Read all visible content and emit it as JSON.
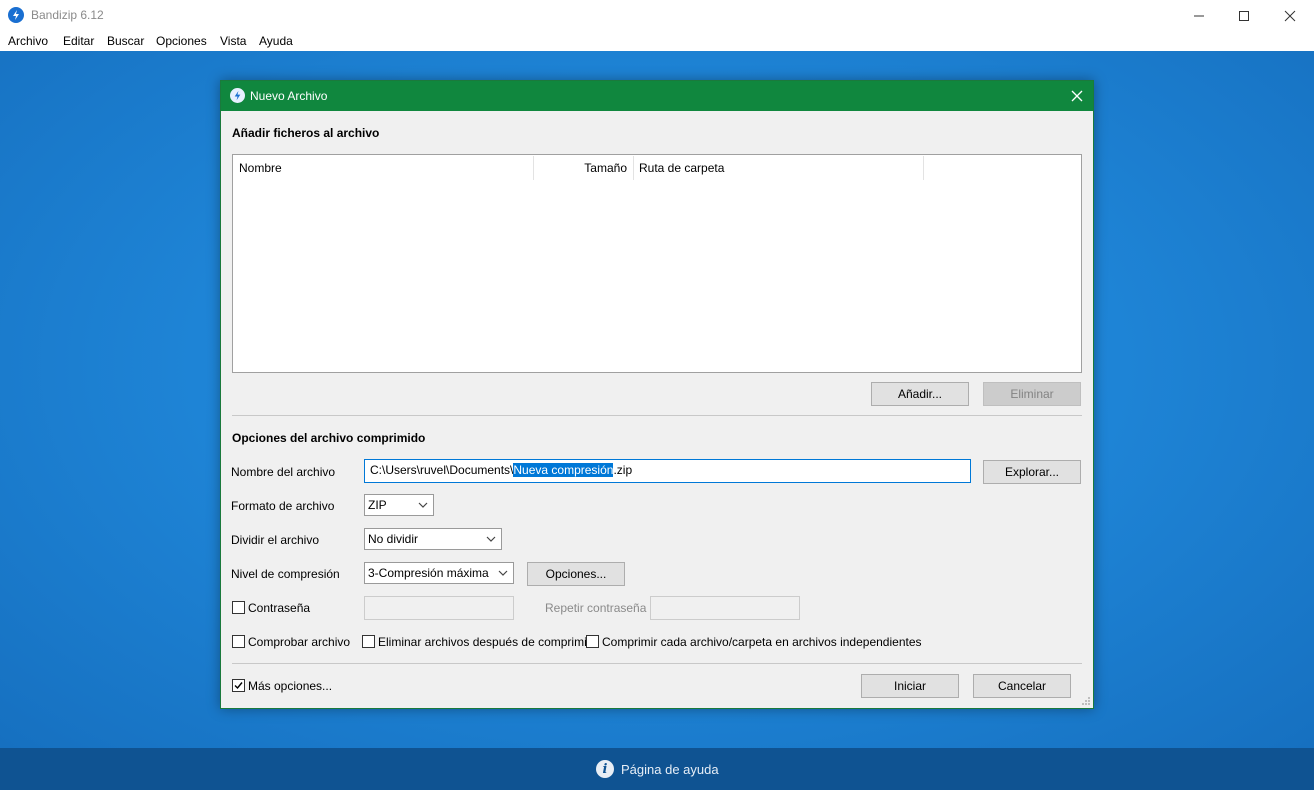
{
  "app": {
    "title": "Bandizip 6.12"
  },
  "menu": [
    "Archivo",
    "Editar",
    "Buscar",
    "Opciones",
    "Vista",
    "Ayuda"
  ],
  "help": {
    "label": "Página de ayuda"
  },
  "dialog": {
    "title": "Nuevo Archivo",
    "add_section": "Añadir ficheros al archivo",
    "columns": [
      "Nombre",
      "Tamaño",
      "Ruta de carpeta"
    ],
    "add_button": "Añadir...",
    "remove_button": "Eliminar",
    "options_section": "Opciones del archivo comprimido",
    "archive_name_label": "Nombre del archivo",
    "archive_path_prefix": "C:\\Users\\ruvel\\Documents\\",
    "archive_path_selected": "Nueva compresión",
    "archive_path_suffix": ".zip",
    "browse_button": "Explorar...",
    "format_label": "Formato de archivo",
    "format_value": "ZIP",
    "split_label": "Dividir el archivo",
    "split_value": "No dividir",
    "level_label": "Nivel de compresión",
    "level_value": "3-Compresión máxima",
    "level_options_button": "Opciones...",
    "password_label": "Contraseña",
    "repeat_password_label": "Repetir contraseña",
    "test_label": "Comprobar archivo",
    "delete_after_label": "Eliminar archivos después de comprimir",
    "each_separately_label": "Comprimir cada archivo/carpeta en archivos independientes",
    "more_options_label": "Más opciones...",
    "start_button": "Iniciar",
    "cancel_button": "Cancelar",
    "checks": {
      "password": false,
      "test": false,
      "delete_after": false,
      "each_separately": false,
      "more_options": true
    }
  },
  "colors": {
    "dialog_title": "#10873e",
    "accent": "#0078d7",
    "helpbar": "#0f5392",
    "workspace": "#1f86d8"
  },
  "icons": [
    "bandizip-icon",
    "minimize-icon",
    "maximize-icon",
    "close-icon",
    "info-icon",
    "chevron-down-icon",
    "checkmark-icon",
    "resize-grip-icon"
  ]
}
